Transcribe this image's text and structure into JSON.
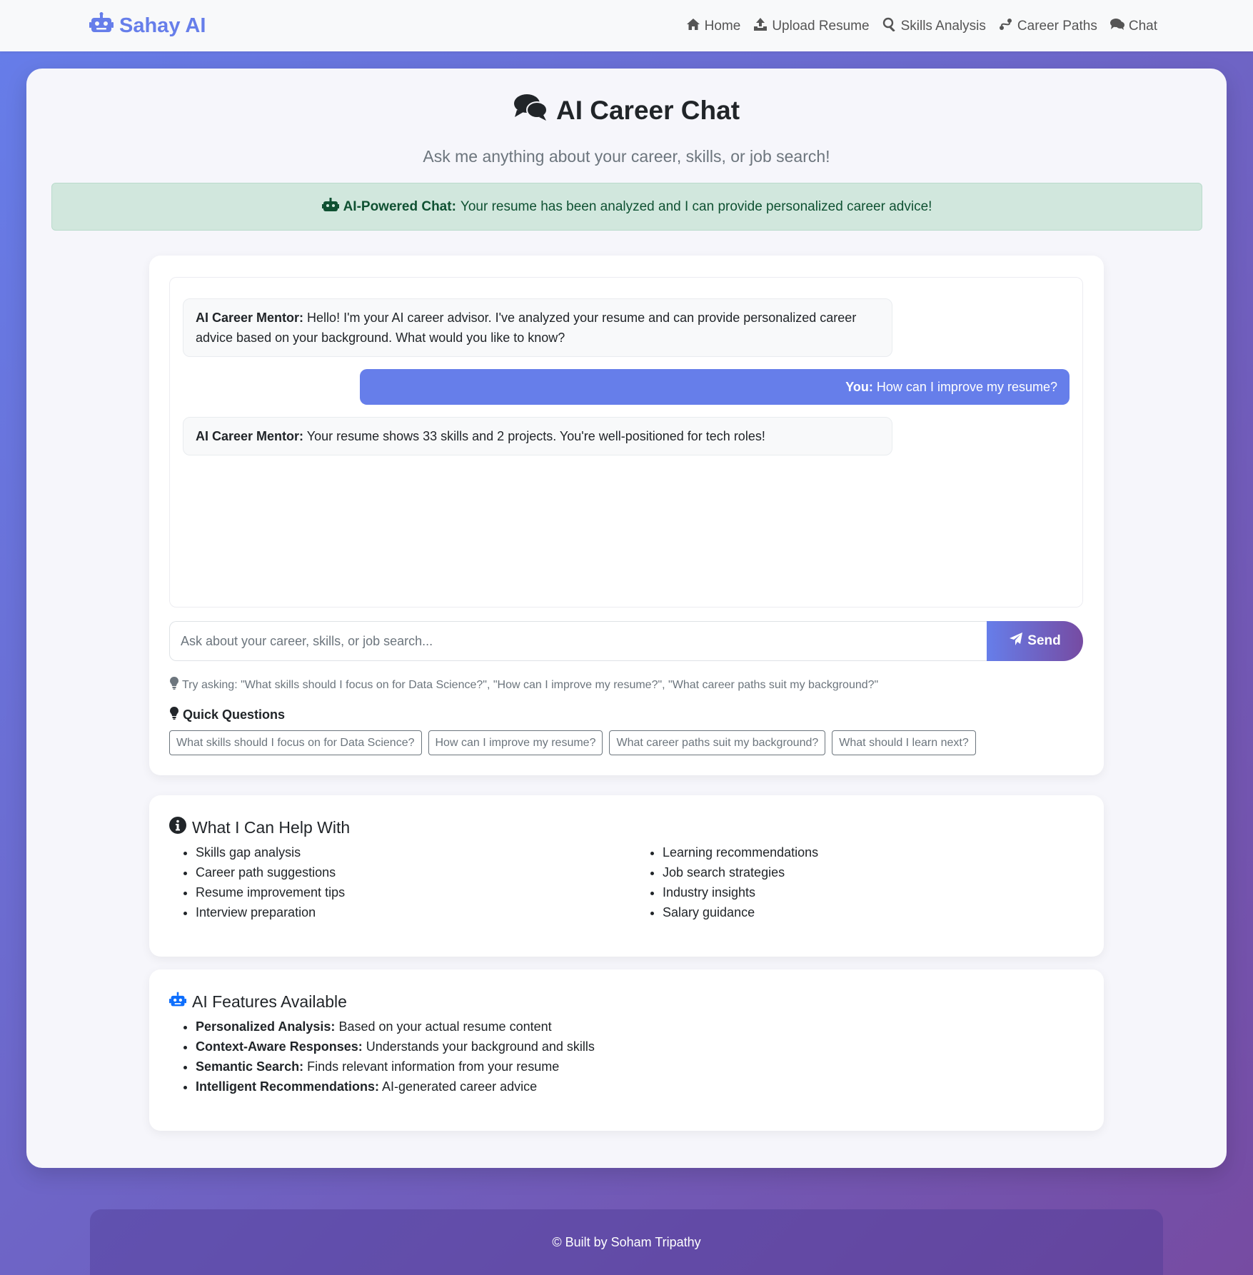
{
  "brand": {
    "name": "Sahay AI",
    "icon": "robot-icon",
    "color": "#667eea"
  },
  "nav": {
    "items": [
      {
        "label": "Home",
        "icon": "home-icon"
      },
      {
        "label": "Upload Resume",
        "icon": "upload-icon"
      },
      {
        "label": "Skills Analysis",
        "icon": "search-icon"
      },
      {
        "label": "Career Paths",
        "icon": "route-icon"
      },
      {
        "label": "Chat",
        "icon": "comments-icon"
      }
    ]
  },
  "header": {
    "title": "AI Career Chat",
    "subtitle": "Ask me anything about your career, skills, or job search!"
  },
  "alert": {
    "label": "AI-Powered Chat:",
    "text": "Your resume has been analyzed and I can provide personalized career advice!",
    "bg": "#d1e7dd",
    "color": "#0f5132"
  },
  "chat": {
    "messages": [
      {
        "role": "ai",
        "sender": "AI Career Mentor:",
        "text": "Hello! I'm your AI career advisor. I've analyzed your resume and can provide personalized career advice based on your background. What would you like to know?"
      },
      {
        "role": "user",
        "sender": "You:",
        "text": "How can I improve my resume?"
      },
      {
        "role": "ai",
        "sender": "AI Career Mentor:",
        "text": "Your resume shows 33 skills and 2 projects. You're well-positioned for tech roles!"
      }
    ],
    "input_placeholder": "Ask about your career, skills, or job search...",
    "input_value": "",
    "send_label": "Send",
    "hint": "Try asking: \"What skills should I focus on for Data Science?\", \"How can I improve my resume?\", \"What career paths suit my background?\""
  },
  "quick_questions": {
    "title": "Quick Questions",
    "items": [
      "What skills should I focus on for Data Science?",
      "How can I improve my resume?",
      "What career paths suit my background?",
      "What should I learn next?"
    ]
  },
  "help": {
    "title": "What I Can Help With",
    "col1": [
      "Skills gap analysis",
      "Career path suggestions",
      "Resume improvement tips",
      "Interview preparation"
    ],
    "col2": [
      "Learning recommendations",
      "Job search strategies",
      "Industry insights",
      "Salary guidance"
    ]
  },
  "features": {
    "title": "AI Features Available",
    "items": [
      {
        "label": "Personalized Analysis:",
        "text": "Based on your actual resume content"
      },
      {
        "label": "Context-Aware Responses:",
        "text": "Understands your background and skills"
      },
      {
        "label": "Semantic Search:",
        "text": "Finds relevant information from your resume"
      },
      {
        "label": "Intelligent Recommendations:",
        "text": "AI-generated career advice"
      }
    ]
  },
  "footer": {
    "text": "© Built by Soham Tripathy"
  },
  "colors": {
    "accent": "#667eea",
    "accent2": "#764ba2",
    "feature_icon": "#0d6efd"
  }
}
